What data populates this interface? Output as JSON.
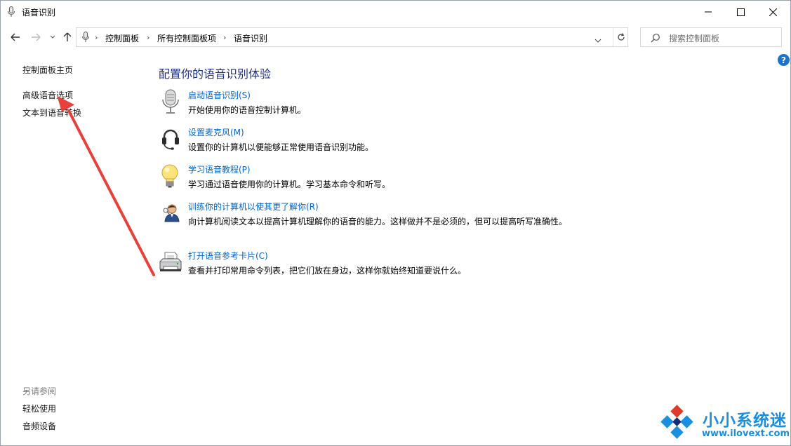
{
  "window": {
    "title": "语音识别"
  },
  "breadcrumb": [
    "控制面板",
    "所有控制面板项",
    "语音识别"
  ],
  "search": {
    "placeholder": "搜索控制面板"
  },
  "help": {
    "label": "?"
  },
  "sidebar": {
    "links": [
      "控制面板主页",
      "高级语音选项",
      "文本到语音转换"
    ],
    "see_also_label": "另请参阅",
    "see_also": [
      "轻松使用",
      "音频设备"
    ]
  },
  "main": {
    "title": "配置你的语音识别体验",
    "tasks": [
      {
        "icon": "microphone-icon",
        "label": "启动语音识别(S)",
        "desc": "开始使用你的语音控制计算机。"
      },
      {
        "icon": "headset-icon",
        "label": "设置麦克风(M)",
        "desc": "设置你的计算机以便能够正常使用语音识别功能。"
      },
      {
        "icon": "lightbulb-icon",
        "label": "学习语音教程(P)",
        "desc": "学习通过语音使用你的计算机。学习基本命令和听写。"
      },
      {
        "icon": "user-icon",
        "label": "训练你的计算机以使其更了解你(R)",
        "desc": "向计算机阅读文本以提高计算机理解你的语音的能力。这样做并不是必须的，但可以提高听写准确性。"
      },
      {
        "icon": "printer-icon",
        "label": "打开语音参考卡片(C)",
        "desc": "查看并打印常用命令列表，把它们放在身边，这样你就始终知道要说什么。"
      }
    ]
  },
  "watermark": {
    "title": "小小系统迷",
    "url": "www.ilovext.com"
  },
  "colors": {
    "link": "#0066cc",
    "title": "#1e3287",
    "annotation_arrow": "#e8403a",
    "watermark": "#1a8fe0"
  }
}
